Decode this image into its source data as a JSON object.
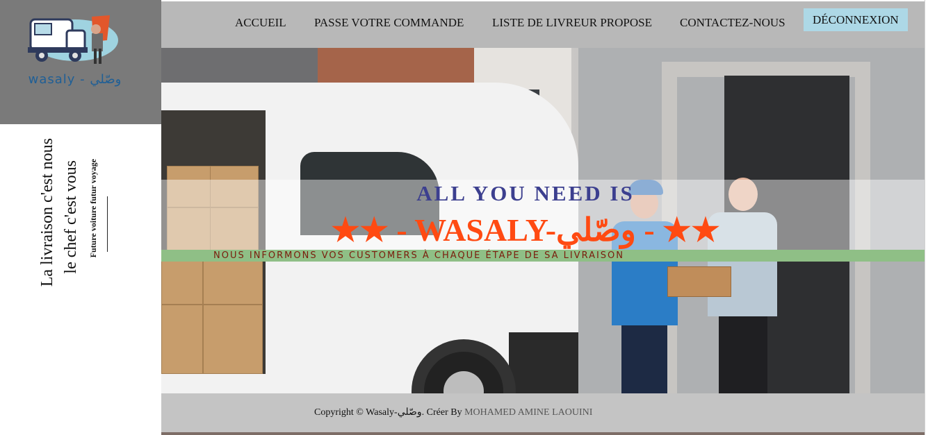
{
  "brand": {
    "logo_text": "wasaly - وصّلي",
    "logo_icon": "delivery-truck-logo"
  },
  "sidebar": {
    "line1": "La livraison c'est nous",
    "line2": "le chef c'est vous",
    "line3": "Future voiture futur voyage"
  },
  "nav": {
    "items": [
      {
        "label": "ACCUEIL"
      },
      {
        "label": "PASSE VOTRE COMMANDE"
      },
      {
        "label": "LISTE DE LIVREUR PROPOSE"
      },
      {
        "label": "CONTACTEZ-NOUS"
      }
    ],
    "logout_label": "DÉCONNEXION",
    "logout_bg": "#add8e6"
  },
  "hero": {
    "title1": "ALL YOU NEED IS",
    "title2": "★★ - WASALY-وصّلي - ★★",
    "subtitle": "NOUS INFORMONS VOS CUSTOMERS À CHAQUE ÉTAPE DE SA LIVRAISON",
    "title1_color": "#3c3f8f",
    "title2_color": "#ff4a12",
    "band_color": "#8fbf86"
  },
  "footer": {
    "text": "Copyright © Wasaly-وصّلي. Créer By",
    "author": "MOHAMED AMINE LAOUINI"
  }
}
